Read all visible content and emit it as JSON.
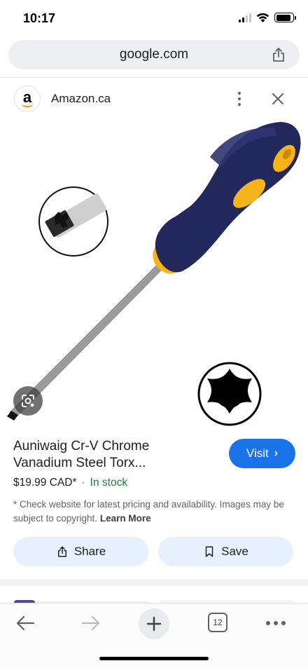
{
  "status_bar": {
    "time": "10:17",
    "signal_bars_active": 2,
    "signal_bars_total": 4,
    "battery_level": 0.9
  },
  "browser": {
    "url": "google.com",
    "share_icon": "share-icon"
  },
  "source": {
    "logo_letter": "a",
    "site_name": "Amazon.ca",
    "more_icon": "more-vert-icon",
    "close_icon": "close-icon"
  },
  "product": {
    "image_description_icon": "screwdriver-product-image",
    "lens_icon": "google-lens-icon",
    "title": "Auniwaig Cr-V Chrome Vanadium Steel Torx...",
    "price": "$19.99 CAD*",
    "separator": "·",
    "availability": "In stock",
    "visit_label": "Visit",
    "visit_chevron": "›",
    "disclaimer": "* Check website for latest pricing and availability. Images may be subject to copyright.",
    "learn_more": "Learn More"
  },
  "actions": {
    "share_label": "Share",
    "save_label": "Save"
  },
  "toolbar": {
    "tab_count": "12",
    "back_icon": "back-arrow-icon",
    "forward_icon": "forward-arrow-icon",
    "new_tab_icon": "plus-icon",
    "menu_icon": "more-horiz-icon"
  },
  "colors": {
    "accent": "#1a73e8",
    "in_stock": "#188038",
    "action_bg": "#e7f0fd",
    "url_bar_bg": "#eeeff2",
    "handle_navy": "#23285c",
    "handle_yellow": "#f5b51a"
  }
}
